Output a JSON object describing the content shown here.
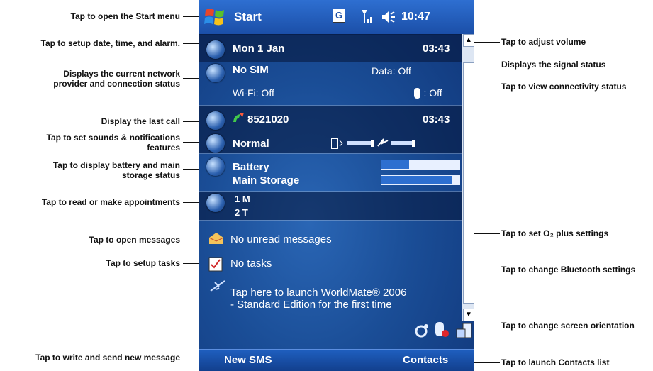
{
  "callouts": {
    "start_menu": "Tap to open the Start menu",
    "date_time": "Tap to setup date, time, and alarm.",
    "network": "Displays the current network provider and connection status",
    "last_call": "Display the last call",
    "sounds": "Tap to set sounds & notifications features",
    "battery": "Tap to display battery and main storage status",
    "appointments": "Tap to read or make appointments",
    "messages": "Tap to open messages",
    "tasks": "Tap to setup tasks",
    "new_message": "Tap to write and send new message",
    "volume": "Tap to adjust volume",
    "signal": "Displays the signal status",
    "connectivity": "Tap to view connectivity status",
    "o2plus": "Tap to set O₂ plus settings",
    "bluetooth": "Tap to change Bluetooth settings",
    "orientation": "Tap to change screen orientation",
    "contacts": "Tap to launch Contacts list"
  },
  "phone": {
    "title": "Start",
    "clock": "10:47",
    "connectivity_icon": "G",
    "date": "Mon 1 Jan",
    "date_time": "03:43",
    "network": "No SIM",
    "data": "Data: Off",
    "wifi": "Wi-Fi: Off",
    "bluetooth": ": Off",
    "last_call_number": "8521020",
    "last_call_time": "03:43",
    "profile": "Normal",
    "battery_label": "Battery",
    "storage_label": "Main Storage",
    "battery_level": 0.35,
    "storage_level": 0.9,
    "appt_1": "1 M",
    "appt_2": "2 T",
    "messages": "No unread messages",
    "tasks": "No tasks",
    "worldmate_line1": "Tap here to launch WorldMate® 2006",
    "worldmate_line2": "- Standard Edition for the first time",
    "softkey_left": "New SMS",
    "softkey_right": "Contacts"
  },
  "colors": {
    "topbar": "#1b4fa8",
    "background": "#1a4d96",
    "battery_fill": "#2d6fd0"
  }
}
